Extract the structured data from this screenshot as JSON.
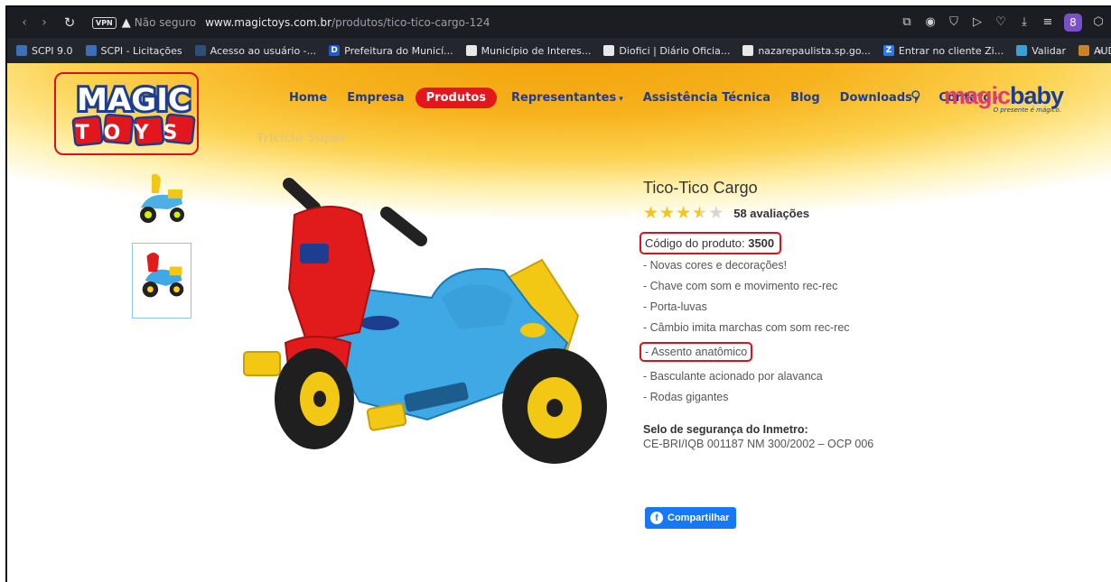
{
  "browser": {
    "vpn_label": "VPN",
    "security_text": "Não seguro",
    "url_domain": "www.magictoys.com.br",
    "url_path": "/produtos/tico-tico-cargo-124",
    "profile_initial": "8"
  },
  "bookmarks": [
    {
      "label": "SCPI 9.0",
      "icon_color": "#3d6fb8"
    },
    {
      "label": "SCPI - Licitações",
      "icon_color": "#3d6fb8"
    },
    {
      "label": "Acesso ao usuário -...",
      "icon_color": "#2d4f7a"
    },
    {
      "label": "Prefeitura do Municí...",
      "icon_color": "#1f5bc9",
      "icon_letter": "D"
    },
    {
      "label": "Município de Interes...",
      "icon_color": "#e8e8e8"
    },
    {
      "label": "Diofici | Diário Oficia...",
      "icon_color": "#e8e8e8"
    },
    {
      "label": "nazarepaulista.sp.go...",
      "icon_color": "#e8e8e8"
    },
    {
      "label": "Entrar no cliente Zi...",
      "icon_color": "#2d7be8",
      "icon_letter": "Z"
    },
    {
      "label": "Validar",
      "icon_color": "#3aa0d8"
    },
    {
      "label": "AUDESP | Tribunal d...",
      "icon_color": "#c8822a"
    }
  ],
  "site": {
    "logo_top": "MAGIC",
    "logo_bottom": "TOYS",
    "menu": [
      {
        "label": "Home",
        "dropdown": false
      },
      {
        "label": "Empresa",
        "dropdown": false
      },
      {
        "label": "Produtos",
        "dropdown": false,
        "active": true
      },
      {
        "label": "Representantes",
        "dropdown": true
      },
      {
        "label": "Assistência Técnica",
        "dropdown": false
      },
      {
        "label": "Blog",
        "dropdown": false
      },
      {
        "label": "Downloads",
        "dropdown": true
      },
      {
        "label": "Contato",
        "dropdown": true
      }
    ],
    "caret": "▾",
    "brand2_part1": "magic",
    "brand2_part2": "baby",
    "brand2_tagline": "O presente é mágico.",
    "ghost_text": "Triciclo Super",
    "colors": {
      "accent_red": "#e2171d",
      "nav_blue": "#1d3d8f",
      "highlight_red": "#d9121b",
      "facebook": "#1877f2"
    }
  },
  "product": {
    "title": "Tico-Tico Cargo",
    "rating": 3.5,
    "rating_max": 5,
    "reviews": "58 avaliações",
    "code_label": "Código do produto:",
    "code_value": "3500",
    "features": [
      "- Novas cores e decorações!",
      "- Chave com som e movimento rec-rec",
      "- Porta-luvas",
      "- Câmbio imita marchas com som rec-rec",
      "- Assento anatômico",
      "- Basculante acionado por alavanca",
      "- Rodas gigantes"
    ],
    "highlighted_feature_index": 4,
    "seal_title": "Selo de segurança do Inmetro:",
    "seal_value": "CE-BRI/IQB 001187 NM 300/2002 – OCP 006",
    "share_label": "Compartilhar"
  }
}
